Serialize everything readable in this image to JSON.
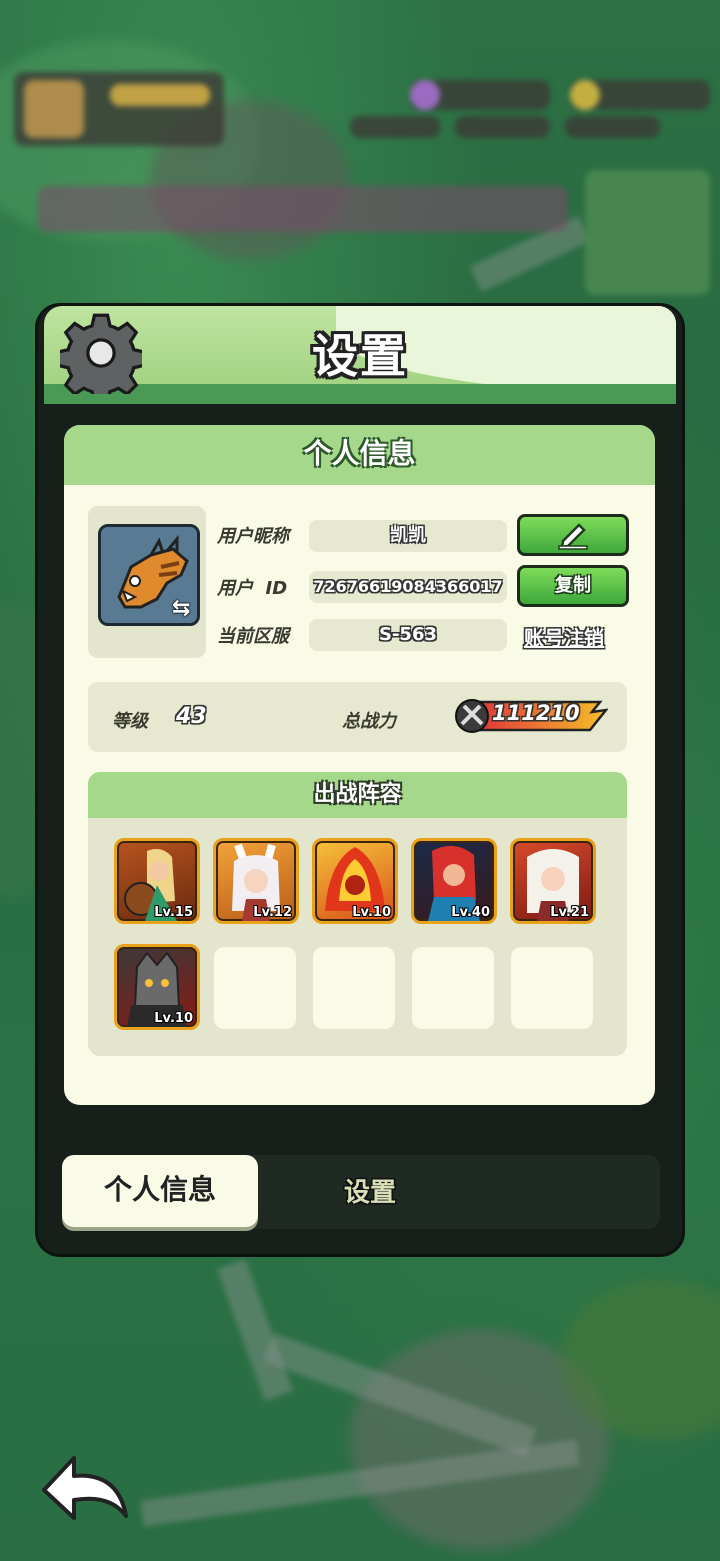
{
  "panel": {
    "title": "设置"
  },
  "profile": {
    "section_title": "个人信息",
    "nickname_label": "用户昵称",
    "nickname_value": "凯凯",
    "id_label": "用户  ID",
    "id_value": "72676619084366017",
    "server_label": "当前区服",
    "server_value": "S-563",
    "edit_icon": "pencil-icon",
    "copy_label": "复制",
    "delete_account_label": "账号注销"
  },
  "stats": {
    "level_label": "等级",
    "level_value": "43",
    "power_label": "总战力",
    "power_value": "111210"
  },
  "lineup": {
    "title": "出战阵容",
    "heroes": [
      {
        "level": "Lv.15"
      },
      {
        "level": "Lv.12"
      },
      {
        "level": "Lv.10"
      },
      {
        "level": "Lv.40"
      },
      {
        "level": "Lv.21"
      },
      {
        "level": "Lv.10"
      }
    ]
  },
  "tabs": {
    "active": "个人信息",
    "other": "设置"
  },
  "colors": {
    "accent_green": "#3ea83b",
    "header_green": "#a6d88c",
    "card_bg": "#f9fbe7",
    "hero_border": "#e9a21c"
  }
}
